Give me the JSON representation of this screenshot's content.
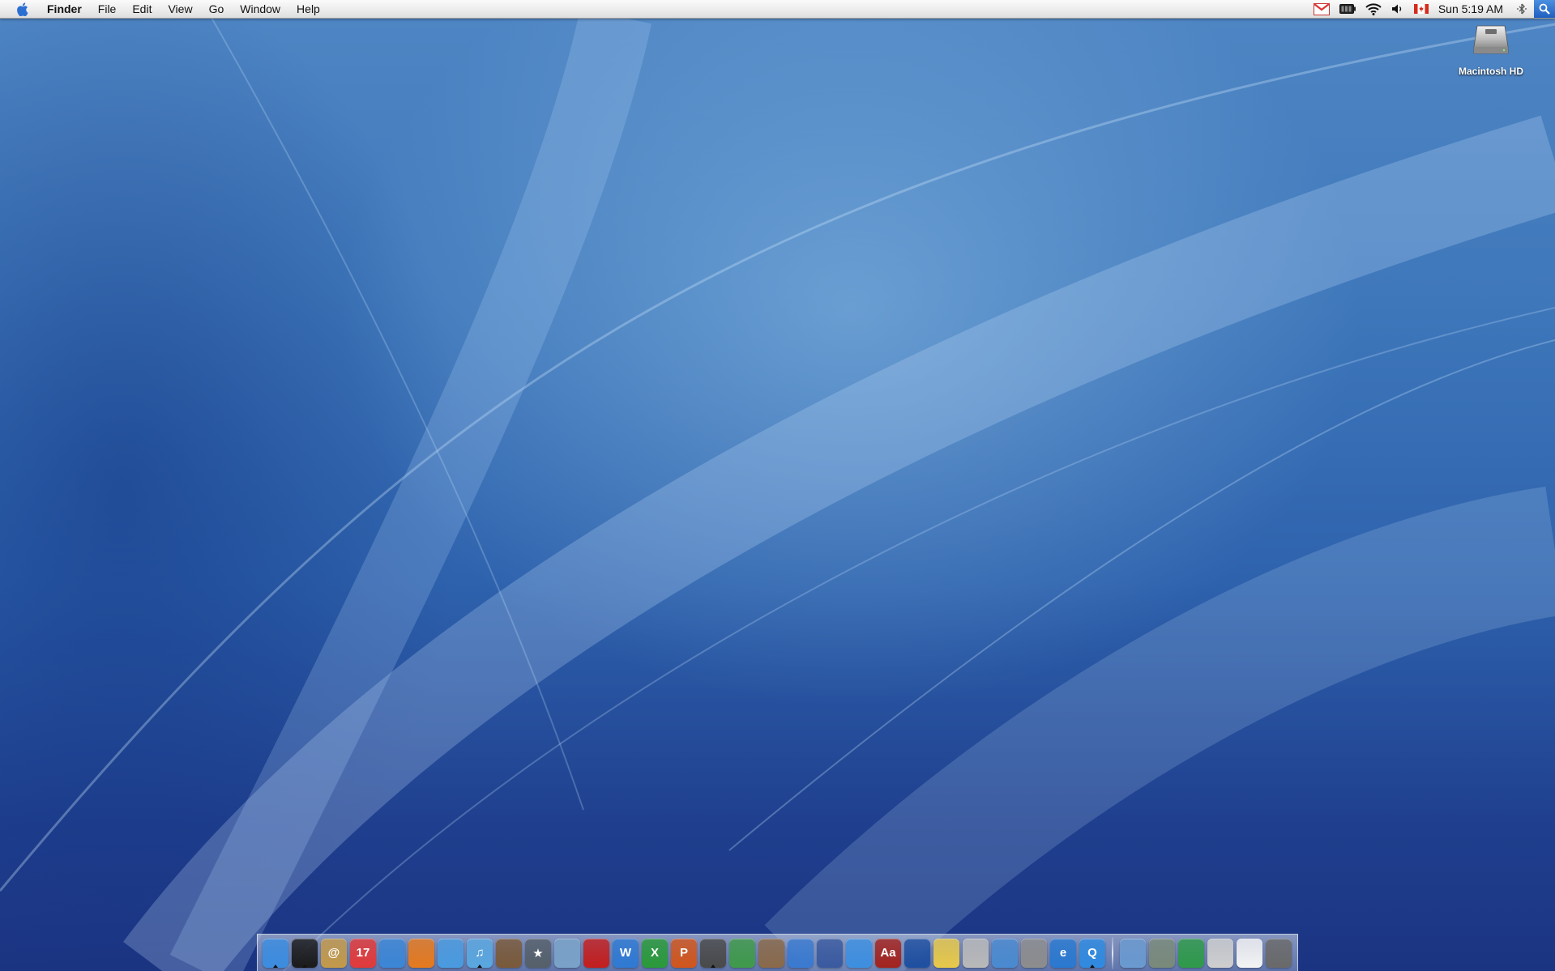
{
  "menubar": {
    "apple_icon": "apple-logo-icon",
    "app_name": "Finder",
    "menus": [
      "File",
      "Edit",
      "View",
      "Go",
      "Window",
      "Help"
    ],
    "status_icons": [
      "gmail-icon",
      "battery-icon",
      "wifi-icon",
      "volume-icon",
      "canada-flag-icon"
    ],
    "clock": "Sun 5:19 AM",
    "extras": [
      "bluetooth-icon",
      "spotlight-icon"
    ]
  },
  "desktop": {
    "icons": [
      {
        "label": "Macintosh HD",
        "icon": "hard-drive-icon"
      }
    ]
  },
  "dock": {
    "apps": [
      {
        "name": "finder",
        "glyph": "",
        "color": "#3c8de0",
        "running": true
      },
      {
        "name": "dashboard",
        "glyph": "",
        "color": "#1b1b1b",
        "running": true
      },
      {
        "name": "address-book",
        "glyph": "@",
        "color": "#c49a4a",
        "running": false
      },
      {
        "name": "ical",
        "glyph": "17",
        "color": "#e23a3a",
        "running": false
      },
      {
        "name": "safari",
        "glyph": "",
        "color": "#3b86d6",
        "running": false
      },
      {
        "name": "firefox",
        "glyph": "",
        "color": "#e67a1e",
        "running": false
      },
      {
        "name": "network-utility",
        "glyph": "",
        "color": "#4a9be0",
        "running": false
      },
      {
        "name": "itunes",
        "glyph": "♫",
        "color": "#5aa7e0",
        "running": true
      },
      {
        "name": "iphoto",
        "glyph": "",
        "color": "#7a5a3a",
        "running": false
      },
      {
        "name": "imovie",
        "glyph": "★",
        "color": "#55606a",
        "running": false
      },
      {
        "name": "preview",
        "glyph": "",
        "color": "#7aa3c9",
        "running": false
      },
      {
        "name": "photo-booth",
        "glyph": "",
        "color": "#c31f1f",
        "running": false
      },
      {
        "name": "word",
        "glyph": "W",
        "color": "#2f7ad3",
        "running": false
      },
      {
        "name": "excel",
        "glyph": "X",
        "color": "#2a9a3a",
        "running": false
      },
      {
        "name": "powerpoint",
        "glyph": "P",
        "color": "#d2561c",
        "running": false
      },
      {
        "name": "script-editor",
        "glyph": "",
        "color": "#4a4a4a",
        "running": true
      },
      {
        "name": "numbers",
        "glyph": "",
        "color": "#3f9a4a",
        "running": false
      },
      {
        "name": "keynote",
        "glyph": "",
        "color": "#8a6a4a",
        "running": false
      },
      {
        "name": "messenger",
        "glyph": "",
        "color": "#3a7ad0",
        "running": false
      },
      {
        "name": "automator",
        "glyph": "",
        "color": "#3a5aa0",
        "running": false
      },
      {
        "name": "ichat",
        "glyph": "",
        "color": "#3d8fe0",
        "running": false
      },
      {
        "name": "dictionary",
        "glyph": "Aa",
        "color": "#a3231e",
        "running": false
      },
      {
        "name": "google-earth",
        "glyph": "",
        "color": "#1f4fa0",
        "running": false
      },
      {
        "name": "stickies",
        "glyph": "",
        "color": "#e8c94a",
        "running": false
      },
      {
        "name": "textedit",
        "glyph": "",
        "color": "#b9b9b9",
        "running": false
      },
      {
        "name": "iweb",
        "glyph": "",
        "color": "#4a8ad0",
        "running": false
      },
      {
        "name": "calculator",
        "glyph": "",
        "color": "#8d8d8d",
        "running": false
      },
      {
        "name": "internet-explorer",
        "glyph": "e",
        "color": "#2a79d0",
        "running": false
      },
      {
        "name": "quicktime",
        "glyph": "Q",
        "color": "#2f8ae0",
        "running": true
      }
    ],
    "docs": [
      {
        "name": "applications-folder",
        "color": "#6a9ad0"
      },
      {
        "name": "downloads-stack",
        "color": "#7a8a7a"
      },
      {
        "name": "document-stack",
        "color": "#2f9a4a"
      },
      {
        "name": "screenshot-stack",
        "color": "#cfcfcf"
      },
      {
        "name": "text-document",
        "color": "#f4f4f4"
      },
      {
        "name": "trash",
        "color": "#6a6a6a"
      }
    ]
  }
}
